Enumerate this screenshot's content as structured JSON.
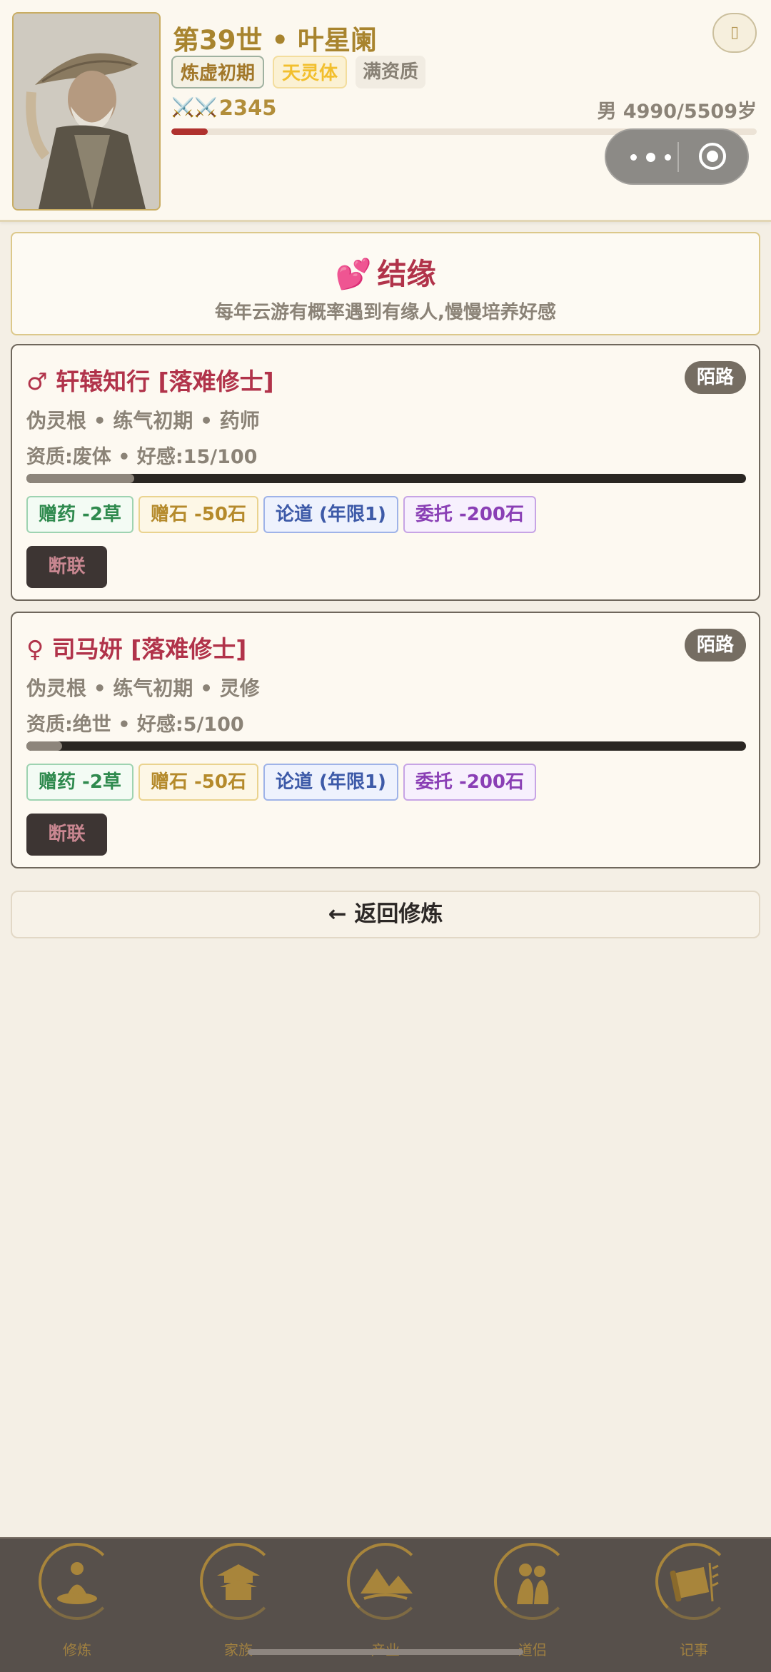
{
  "header": {
    "title": "第39世 • 叶星阑",
    "tags": {
      "realm": "炼虚初期",
      "body": "天灵体",
      "talent": "满资质"
    },
    "power_icon": "⚔️⚔️",
    "power": "2345",
    "age": "男 4990/5509岁",
    "life_ratio": 0.0617,
    "menu_icon": "scroll-icon"
  },
  "section": {
    "icon": "💕",
    "title": "结缘",
    "subtitle": "每年云游有概率遇到有缘人,慢慢培养好感"
  },
  "contacts": [
    {
      "name": "♂ 轩辕知行 [落难修士]",
      "badge": "陌路",
      "line1": "伪灵根 • 练气初期 • 药师",
      "line2": "资质:废体 • 好感:15/100",
      "affinity": 0.15,
      "actions": {
        "herb": "赠药 -2草",
        "stone": "赠石 -50石",
        "dao": "论道 (年限1)",
        "entrust": "委托 -200石"
      },
      "break_label": "断联"
    },
    {
      "name": "♀ 司马妍 [落难修士]",
      "badge": "陌路",
      "line1": "伪灵根 • 练气初期 • 灵修",
      "line2": "资质:绝世 • 好感:5/100",
      "affinity": 0.05,
      "actions": {
        "herb": "赠药 -2草",
        "stone": "赠石 -50石",
        "dao": "论道 (年限1)",
        "entrust": "委托 -200石"
      },
      "break_label": "断联"
    }
  ],
  "back_label": "← 返回修炼",
  "nav": [
    {
      "label": "修炼",
      "icon": "meditating-figure-icon"
    },
    {
      "label": "家族",
      "icon": "pavilion-icon"
    },
    {
      "label": "产业",
      "icon": "mountain-landscape-icon"
    },
    {
      "label": "道侣",
      "icon": "couple-icon"
    },
    {
      "label": "记事",
      "icon": "scroll-icon"
    }
  ]
}
